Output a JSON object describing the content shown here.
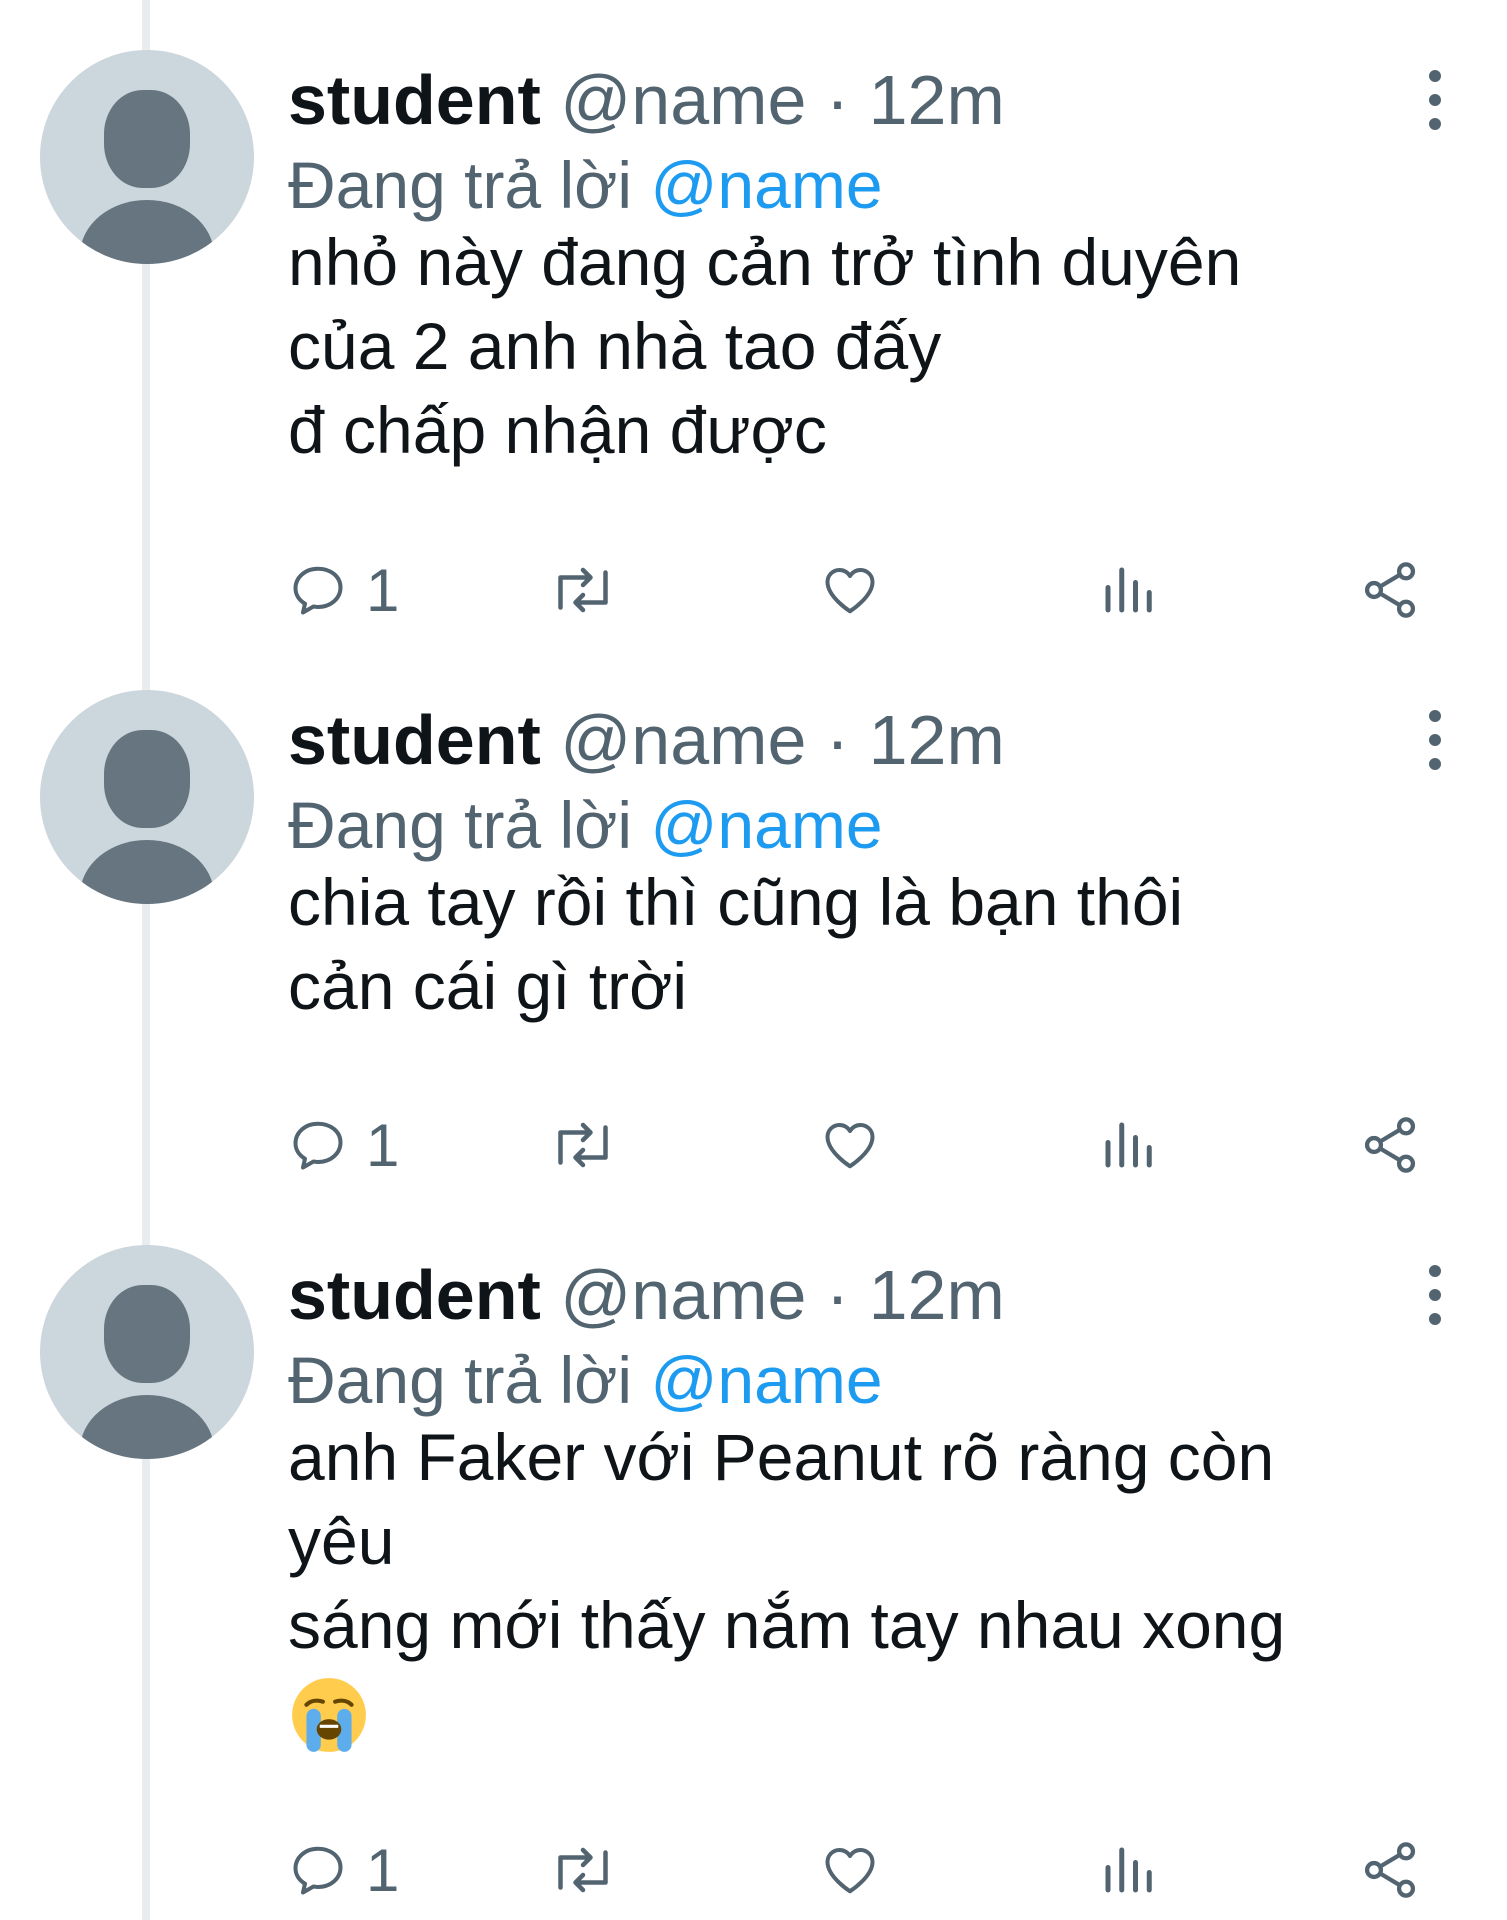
{
  "colors": {
    "text": "#0f1419",
    "secondary": "#536471",
    "accent": "#1d9bf0",
    "avatar_bg": "#ccd6dd",
    "avatar_fg": "#66757f"
  },
  "tweets": [
    {
      "name": "student",
      "handle": "@name",
      "separator": "·",
      "time": "12m",
      "reply_prefix": "Đang trả lời",
      "reply_to": "@name",
      "lines": [
        "nhỏ này đang cản trở tình duyên",
        "của 2 anh nhà tao đấy",
        "đ chấp nhận được"
      ],
      "reply_count": "1"
    },
    {
      "name": "student",
      "handle": "@name",
      "separator": "·",
      "time": "12m",
      "reply_prefix": "Đang trả lời",
      "reply_to": "@name",
      "lines": [
        "chia tay rồi thì cũng là bạn thôi",
        "cản cái gì trời"
      ],
      "reply_count": "1"
    },
    {
      "name": "student",
      "handle": "@name",
      "separator": "·",
      "time": "12m",
      "reply_prefix": "Đang trả lời",
      "reply_to": "@name",
      "lines": [
        "anh Faker với Peanut rõ ràng còn",
        "yêu",
        "sáng mới thấy nắm tay nhau xong"
      ],
      "emoji": "loudly-crying-face-icon",
      "reply_count": "1"
    }
  ]
}
